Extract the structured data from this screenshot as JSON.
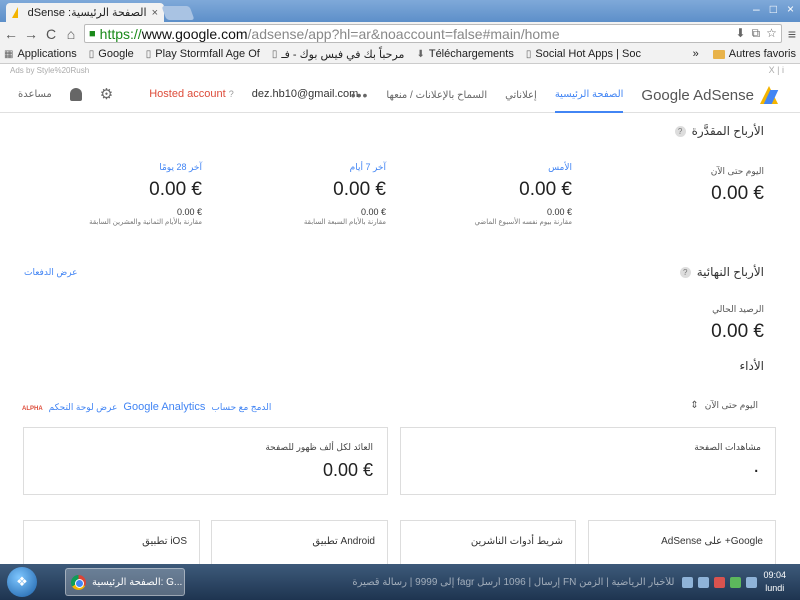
{
  "browser": {
    "tab_title": "الصفحة الرئيسية: AdSense",
    "tab_close": "×",
    "url_scheme": "https://",
    "url_host": "www.google.com",
    "url_path": "/adsense/app?hl=ar&noaccount=false#main/home",
    "window_controls": [
      "–",
      "□",
      "×"
    ],
    "bookmarks": [
      {
        "label": "Applications"
      },
      {
        "label": "Google"
      },
      {
        "label": "Play Stormfall Age Of"
      },
      {
        "label": "مرحباً بك في فيس بوك - فـ"
      },
      {
        "label": "Téléchargements"
      },
      {
        "label": "Social Hot Apps | Soc"
      }
    ],
    "bookmarks_overflow": "»",
    "other_bookmarks": "Autres favoris"
  },
  "ads_banner": {
    "text": "Ads by Style%20Rush",
    "controls": "X | i"
  },
  "header": {
    "brand": "Google AdSense",
    "tabs": [
      {
        "label": "الصفحة الرئيسية",
        "active": true
      },
      {
        "label": "إعلاناتي",
        "active": false
      },
      {
        "label": "السماح بالإعلانات / منعها",
        "active": false
      }
    ],
    "more": "•••",
    "hosted_account": "Hosted account",
    "hosted_help": "?",
    "email": "dez.hb10@gmail.com",
    "help_label": "مساعدة"
  },
  "estimated": {
    "title": "الأرباح المقدَّرة",
    "help": "?",
    "metrics": [
      {
        "label": "اليوم حتى الآن",
        "value": "0.00 €",
        "sub": "",
        "note": ""
      },
      {
        "label": "الأمس",
        "value": "0.00 €",
        "sub": "0.00 €",
        "note": "مقارنة بيوم نفسه الأسبوع الماضي"
      },
      {
        "label": "آخر 7 أيام",
        "value": "0.00 €",
        "sub": "0.00 €",
        "note": "مقارنة بالأيام السبعة السابقة"
      },
      {
        "label": "آخر 28 يومًا",
        "value": "0.00 €",
        "sub": "0.00 €",
        "note": "مقارنة بالأيام الثمانية والعشرين السابقة"
      }
    ]
  },
  "finalized": {
    "title": "الأرباح النهائية",
    "help": "?",
    "view_payments": "عرض الدفعات",
    "balance_label": "الرصيد الحالي",
    "balance_value": "0.00 €"
  },
  "performance": {
    "title": "الأداء",
    "period": "اليوم حتى الآن",
    "period_arrow": "⇕",
    "alpha": "ALPHA",
    "dashboard_link": "عرض لوحة التحكم",
    "analytics_brand": "Google Analytics",
    "integrate_link": "الدمج مع حساب",
    "cards": [
      {
        "label": "مشاهدات الصفحة",
        "value": "٠"
      },
      {
        "label": "العائد لكل ألف ظهور للصفحة",
        "value": "0.00 €"
      }
    ]
  },
  "apps": [
    {
      "label": "AdSense على +Google"
    },
    {
      "label": "شريط أدوات الناشرين"
    },
    {
      "label": "تطبيق Android"
    },
    {
      "label": "تطبيق iOS"
    }
  ],
  "taskbar": {
    "start": "❖",
    "task_label": "الصفحة الرئيسية: G...",
    "ticker": "للأخبار الرياضية | الزمن FN إرسال | 1096 أرسل fagr إلى 9999 | رسالة قصيرة",
    "time": "09:04",
    "day": "lundi"
  }
}
